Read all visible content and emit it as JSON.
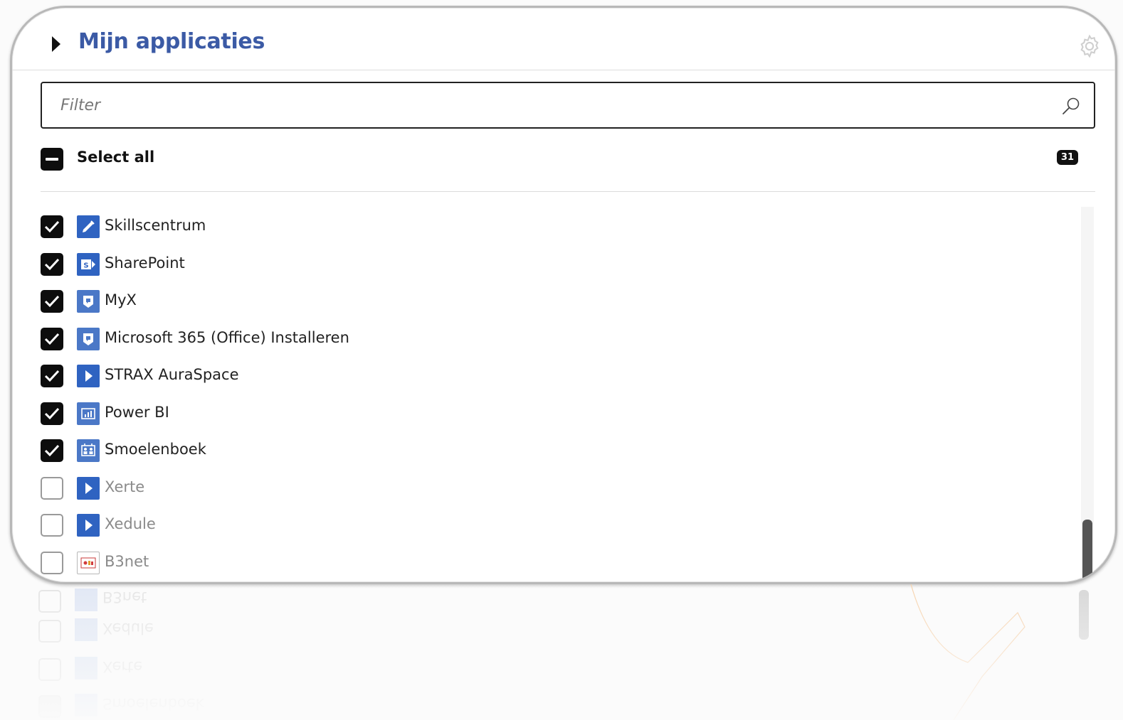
{
  "header": {
    "title": "Mijn applicaties"
  },
  "filter": {
    "placeholder": "Filter"
  },
  "select_all": {
    "label": "Select all",
    "count": "31"
  },
  "apps": [
    {
      "label": "Skillscentrum",
      "checked": true,
      "icon": "pen-icon"
    },
    {
      "label": "SharePoint",
      "checked": true,
      "icon": "sharepoint-icon"
    },
    {
      "label": "MyX",
      "checked": true,
      "icon": "badge-icon"
    },
    {
      "label": "Microsoft 365 (Office) Installeren",
      "checked": true,
      "icon": "badge-icon"
    },
    {
      "label": "STRAX AuraSpace",
      "checked": true,
      "icon": "play-icon"
    },
    {
      "label": "Power BI",
      "checked": true,
      "icon": "chart-icon"
    },
    {
      "label": "Smoelenboek",
      "checked": true,
      "icon": "people-icon"
    },
    {
      "label": "Xerte",
      "checked": false,
      "icon": "play-icon"
    },
    {
      "label": "Xedule",
      "checked": false,
      "icon": "play-icon"
    },
    {
      "label": "B3net",
      "checked": false,
      "icon": "b3net-icon"
    }
  ],
  "colors": {
    "title": "#3b5aa5",
    "app_icon": "#2f63c1",
    "checkbox": "#0d0d0d"
  }
}
